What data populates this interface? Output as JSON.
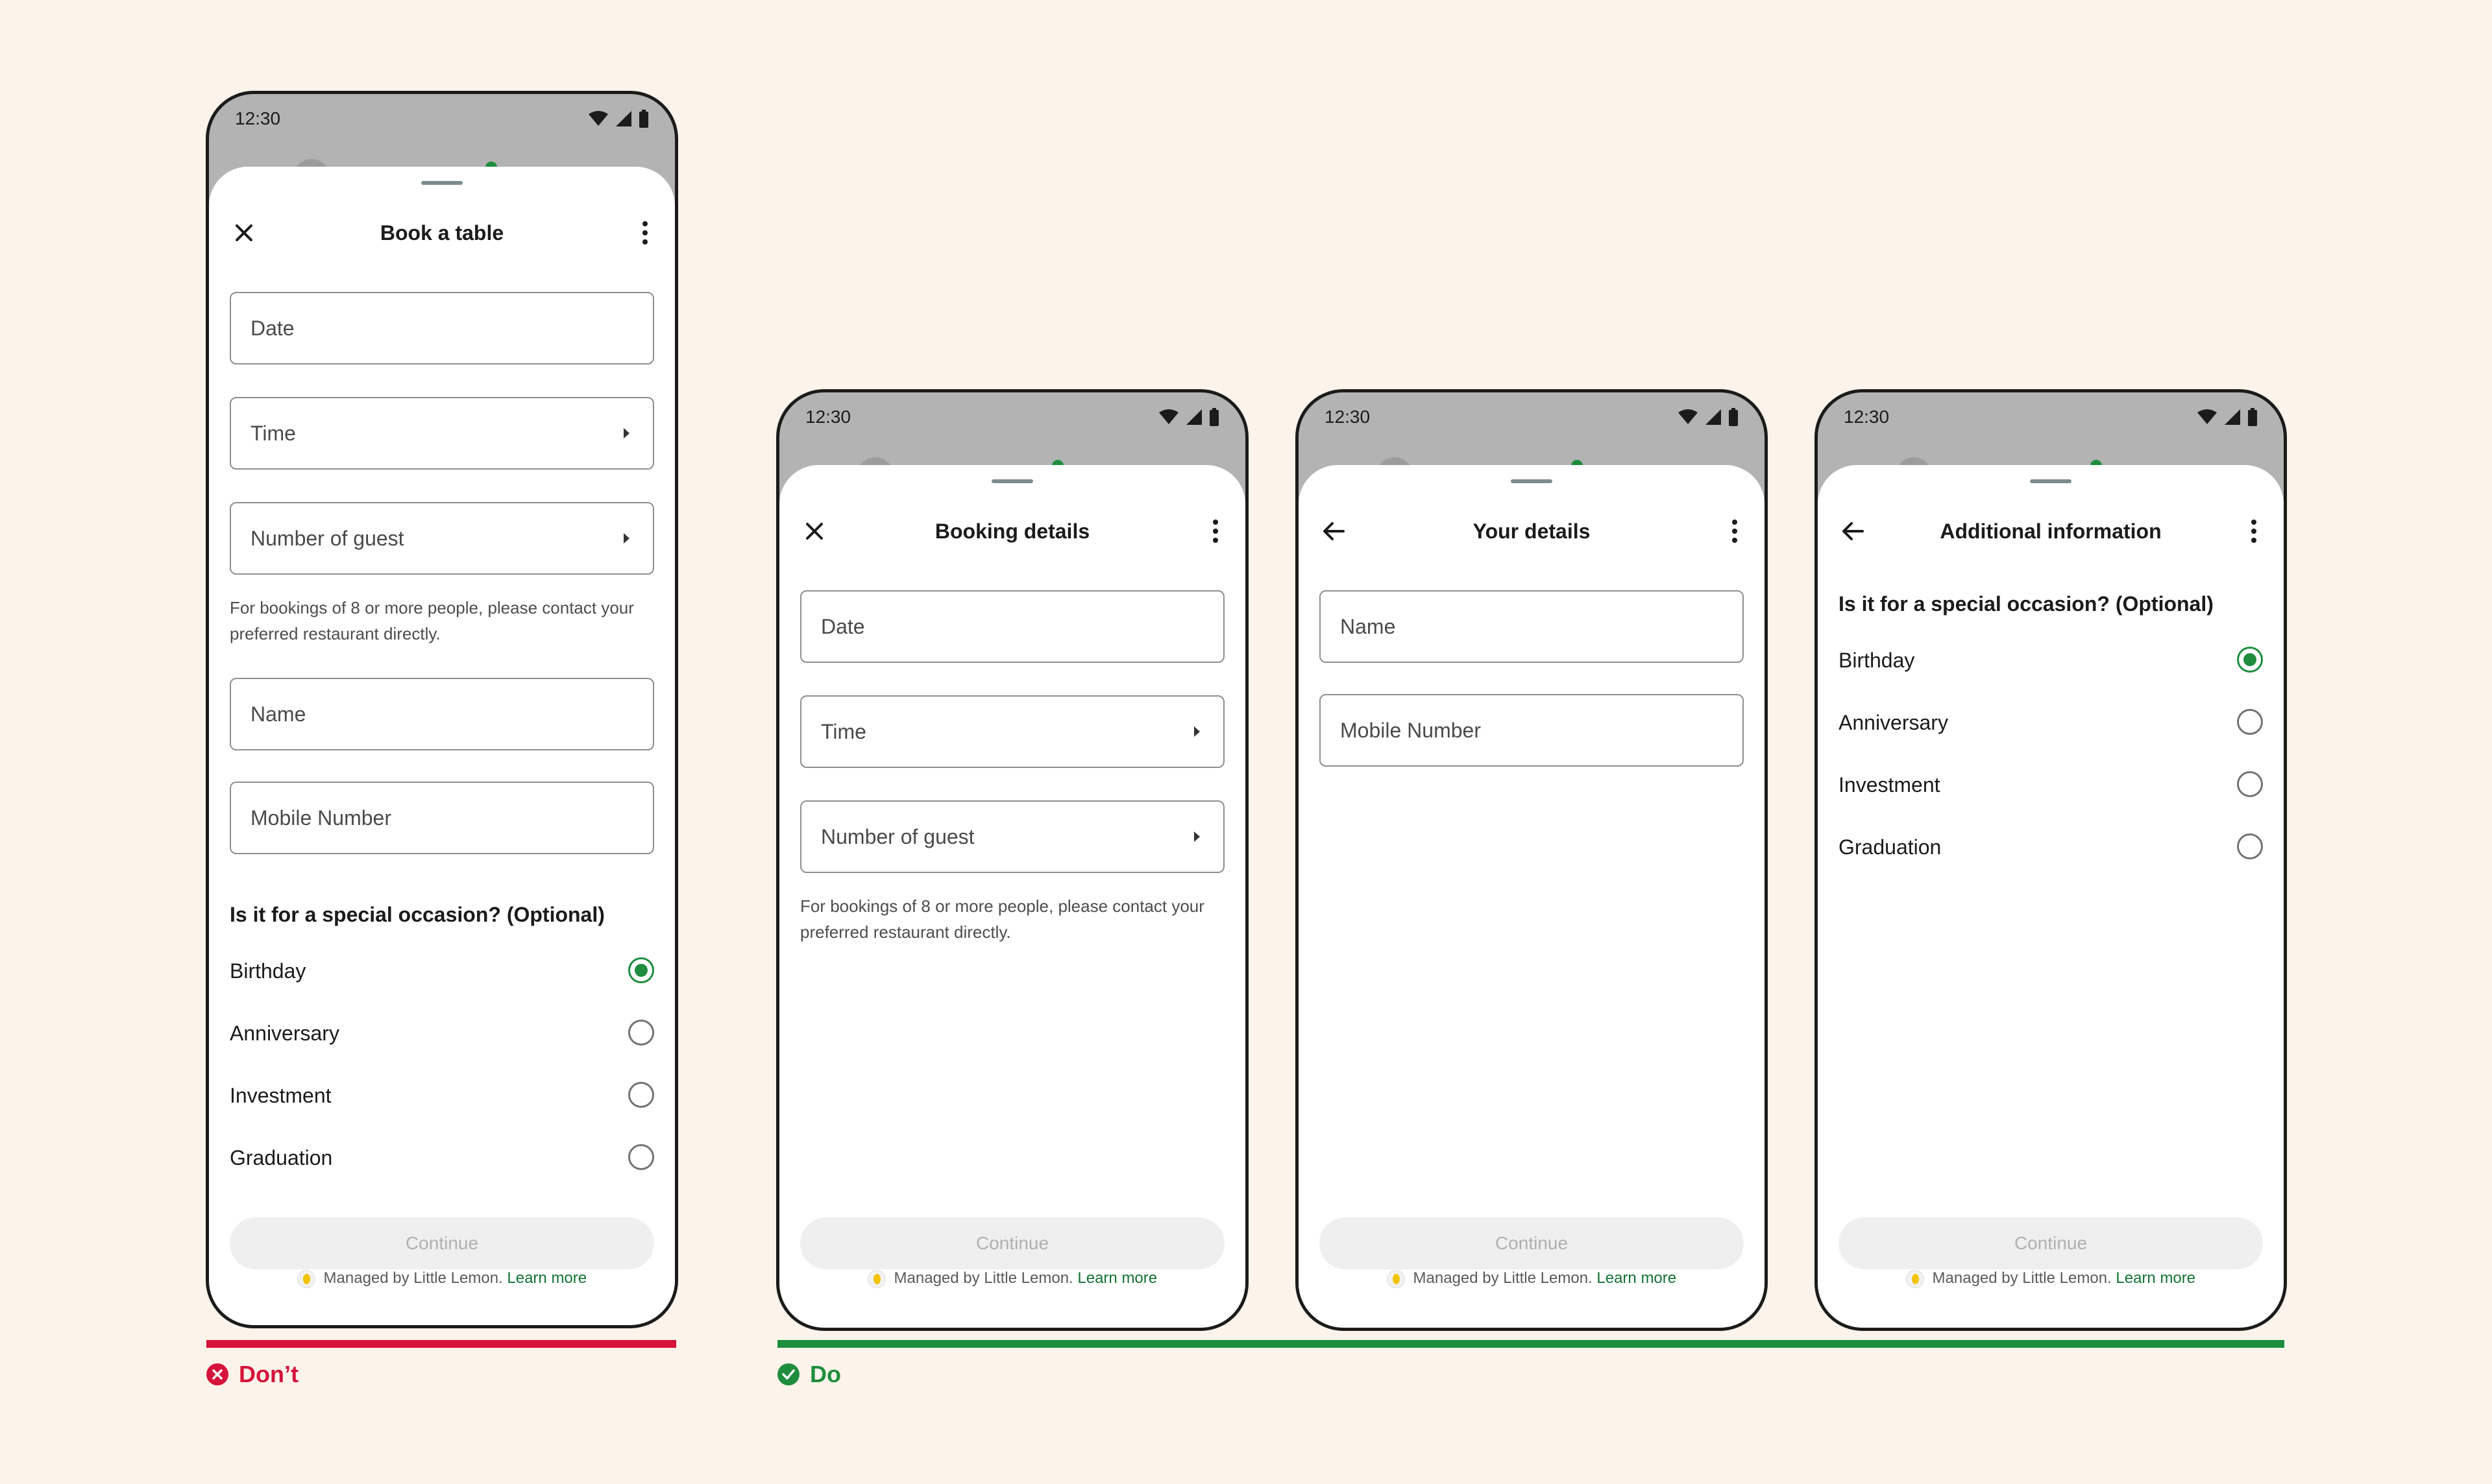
{
  "colors": {
    "background": "#fcf4ea",
    "dont": "#d6133a",
    "do": "#1e8e3e",
    "radio_checked": "#1e8e3e"
  },
  "status": {
    "time": "12:30"
  },
  "footer": {
    "managed": "Managed by Little Lemon.",
    "learn_more": "Learn more"
  },
  "continue_label": "Continue",
  "helper_text": "For bookings of 8 or more people, please contact your preferred restaurant directly.",
  "verdicts": {
    "dont": "Don’t",
    "do": "Do"
  },
  "screens": {
    "book": {
      "title": "Book a table",
      "nav_icon": "close-icon",
      "fields": {
        "date": "Date",
        "time": "Time",
        "guests": "Number of guest",
        "name": "Name",
        "mobile": "Mobile Number"
      },
      "occasion_title": "Is it for a special occasion? (Optional)",
      "options": [
        {
          "label": "Birthday",
          "selected": true
        },
        {
          "label": "Anniversary",
          "selected": false
        },
        {
          "label": "Investment",
          "selected": false
        },
        {
          "label": "Graduation",
          "selected": false
        }
      ]
    },
    "booking": {
      "title": "Booking details",
      "nav_icon": "close-icon",
      "fields": {
        "date": "Date",
        "time": "Time",
        "guests": "Number of guest"
      }
    },
    "your": {
      "title": "Your details",
      "nav_icon": "back-arrow-icon",
      "fields": {
        "name": "Name",
        "mobile": "Mobile Number"
      }
    },
    "additional": {
      "title": "Additional information",
      "nav_icon": "back-arrow-icon",
      "occasion_title": "Is it for a special occasion? (Optional)",
      "options": [
        {
          "label": "Birthday",
          "selected": true
        },
        {
          "label": "Anniversary",
          "selected": false
        },
        {
          "label": "Investment",
          "selected": false
        },
        {
          "label": "Graduation",
          "selected": false
        }
      ]
    }
  }
}
